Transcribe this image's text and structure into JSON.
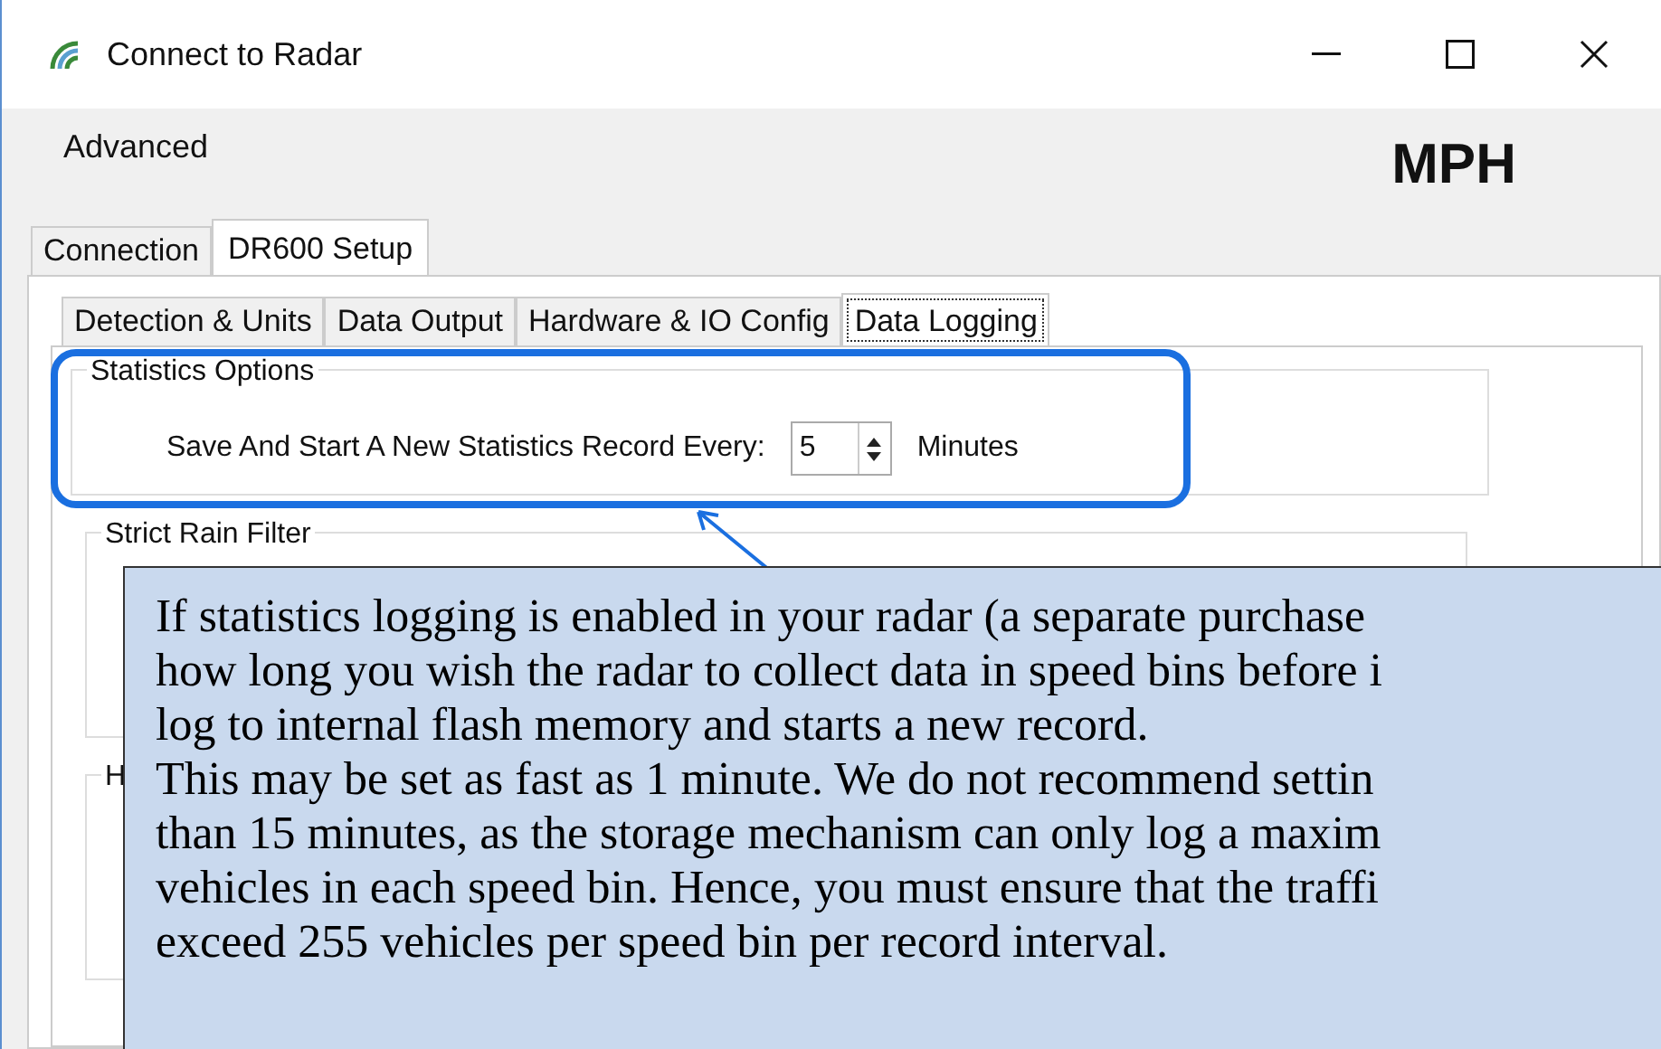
{
  "window": {
    "title": "Connect to Radar"
  },
  "menu": [
    "Advanced"
  ],
  "units": "MPH",
  "tabs": [
    {
      "label": "Connection",
      "selected": false
    },
    {
      "label": "DR600 Setup",
      "selected": true
    }
  ],
  "subtabs": [
    {
      "label": "Detection & Units",
      "selected": false
    },
    {
      "label": "Data Output",
      "selected": false
    },
    {
      "label": "Hardware & IO Config",
      "selected": false
    },
    {
      "label": "Data Logging",
      "selected": true
    }
  ],
  "statistics_options": {
    "title": "Statistics Options",
    "label": "Save And Start A New Statistics Record Every:",
    "value": "5",
    "unit": "Minutes"
  },
  "groups": [
    {
      "title": "Strict Rain Filter"
    },
    {
      "title": "H"
    }
  ],
  "callout": {
    "lines": [
      "If statistics logging is enabled in your radar (a separate purchase",
      "how long you wish the radar to collect data in speed bins before i",
      "log to internal flash memory and starts a new record.",
      "This may be set as fast as 1 minute. We do not recommend settin",
      "than 15 minutes, as the storage mechanism can only log a maxim",
      "vehicles in each speed bin. Hence, you must ensure that the traffi",
      "exceed 255 vehicles per speed bin per record interval."
    ]
  }
}
